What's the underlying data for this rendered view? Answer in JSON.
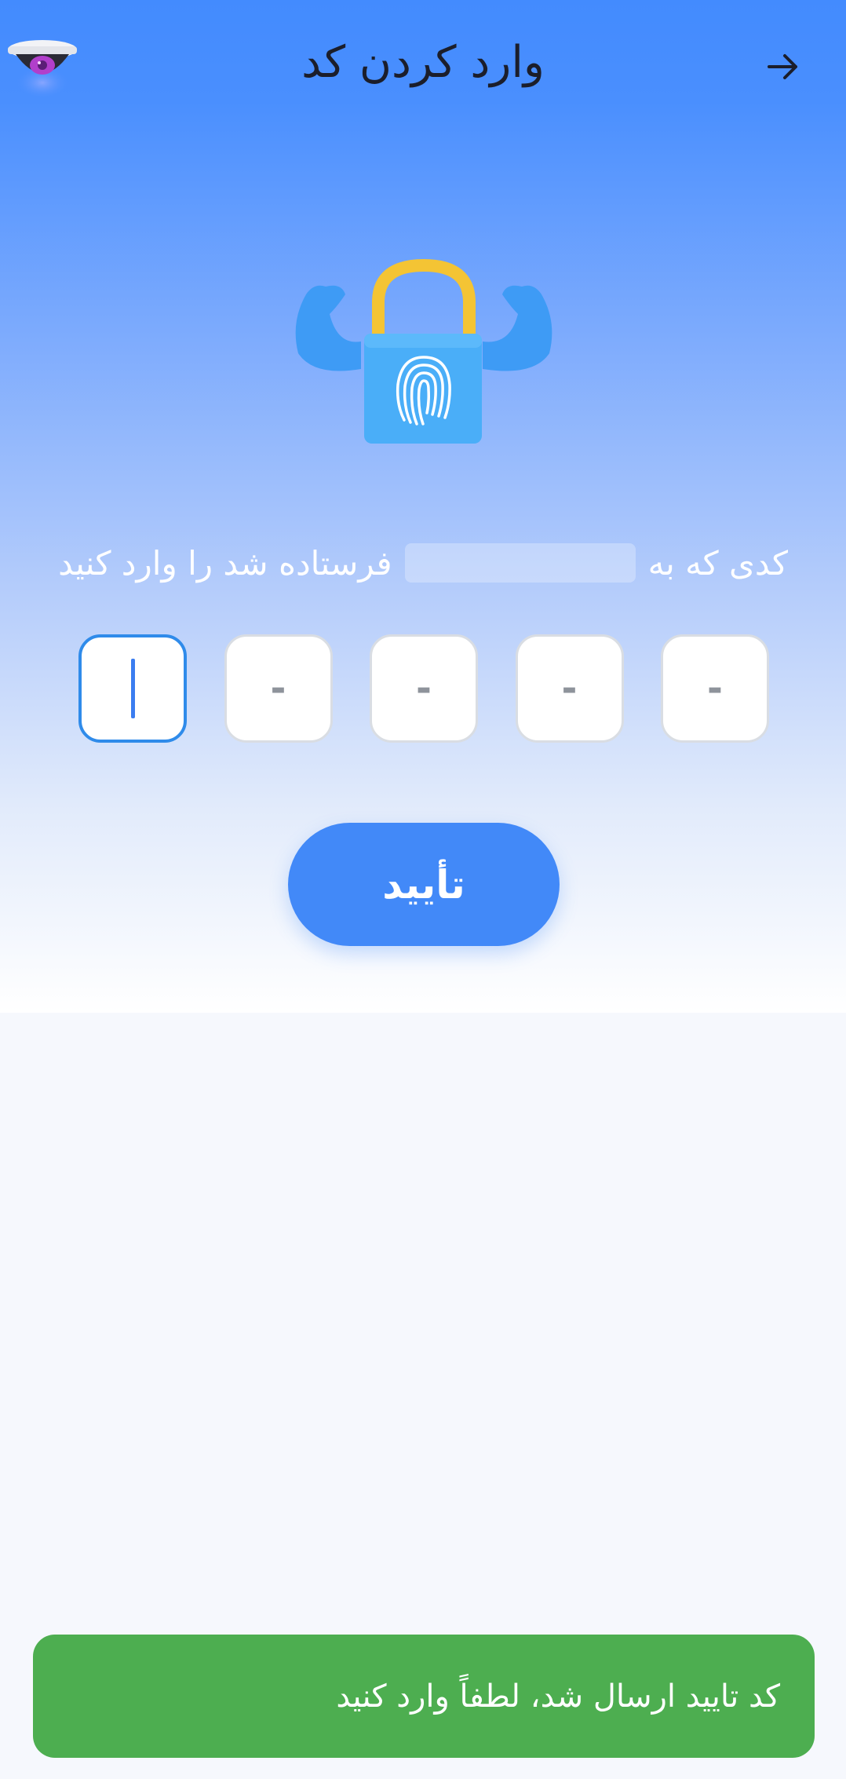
{
  "header": {
    "title": "وارد کردن کد",
    "back_icon": "arrow-right-icon",
    "logo_icon": "security-camera-icon"
  },
  "illustration": {
    "icon": "fingerprint-lock-muscles-icon"
  },
  "instruction": {
    "prefix": "کدی که به",
    "suffix": "فرستاده شد را وارد کنید"
  },
  "otp": {
    "digits": [
      "",
      "-",
      "-",
      "-",
      "-"
    ]
  },
  "confirm_button": {
    "label": "تأیید"
  },
  "toast": {
    "message": "کد تایید ارسال شد، لطفاً وارد کنید"
  },
  "colors": {
    "primary": "#4289F8",
    "toast": "#4DAE50",
    "active_border": "#2F8BEA"
  }
}
